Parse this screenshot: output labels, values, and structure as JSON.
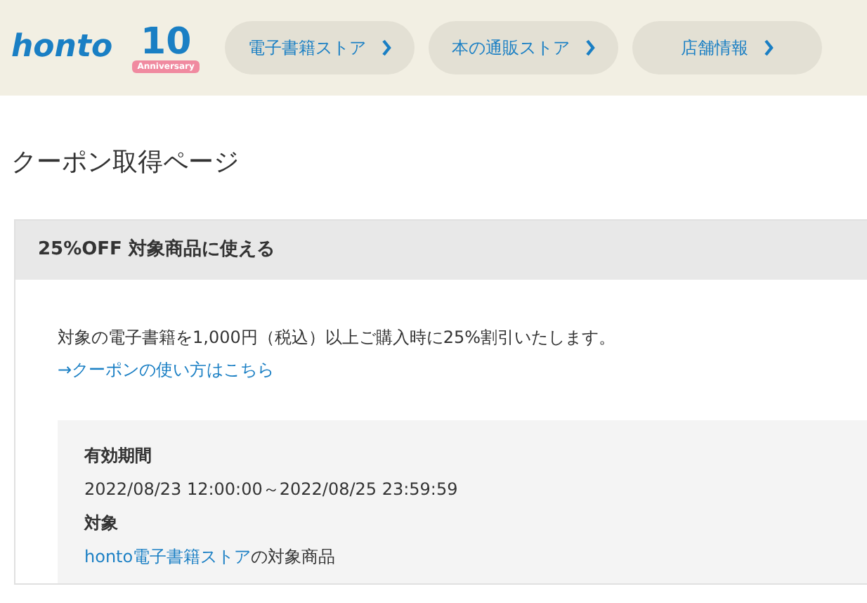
{
  "header": {
    "logo": "honto",
    "anniversary": {
      "number": "10",
      "ribbon": "Anniversary"
    },
    "nav": [
      {
        "label": "電子書籍ストア"
      },
      {
        "label": "本の通販ストア"
      },
      {
        "label": "店舗情報"
      }
    ]
  },
  "page_title": "クーポン取得ページ",
  "coupon": {
    "title": "25%OFF 対象商品に使える",
    "description": "対象の電子書籍を1,000円（税込）以上ご購入時に25%割引いたします。",
    "how_to_link": "→クーポンの使い方はこちら",
    "details": [
      {
        "heading": "有効期間",
        "value": "2022/08/23 12:00:00～2022/08/25 23:59:59"
      },
      {
        "heading": "対象",
        "link": "honto電子書籍ストア",
        "value": "の対象商品"
      }
    ]
  }
}
